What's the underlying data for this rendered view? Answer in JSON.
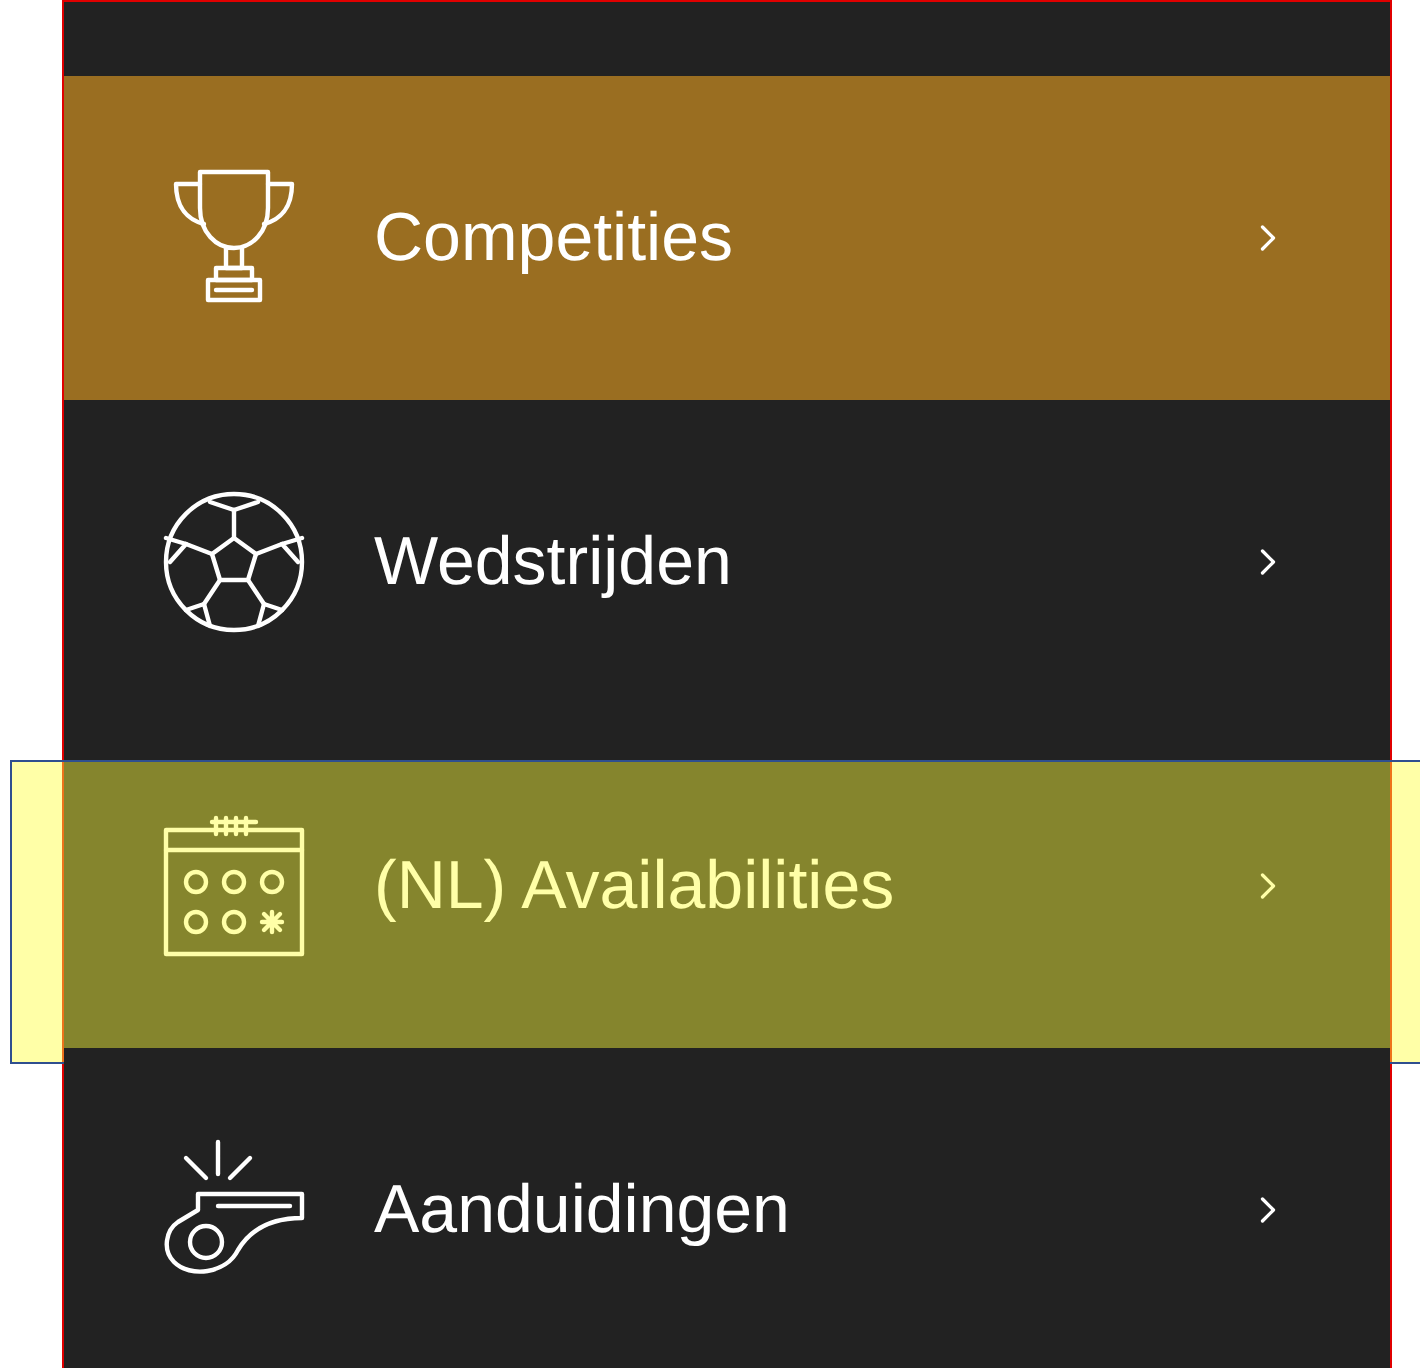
{
  "menu": {
    "items": [
      {
        "kind": "trophy",
        "label": "Competities",
        "selected": true,
        "highlighted": false
      },
      {
        "kind": "ball",
        "label": "Wedstrijden",
        "selected": false,
        "highlighted": false
      },
      {
        "kind": "calendar",
        "label": "(NL) Availabilities",
        "selected": false,
        "highlighted": true
      },
      {
        "kind": "whistle",
        "label": "Aanduidingen",
        "selected": false,
        "highlighted": false
      }
    ]
  }
}
